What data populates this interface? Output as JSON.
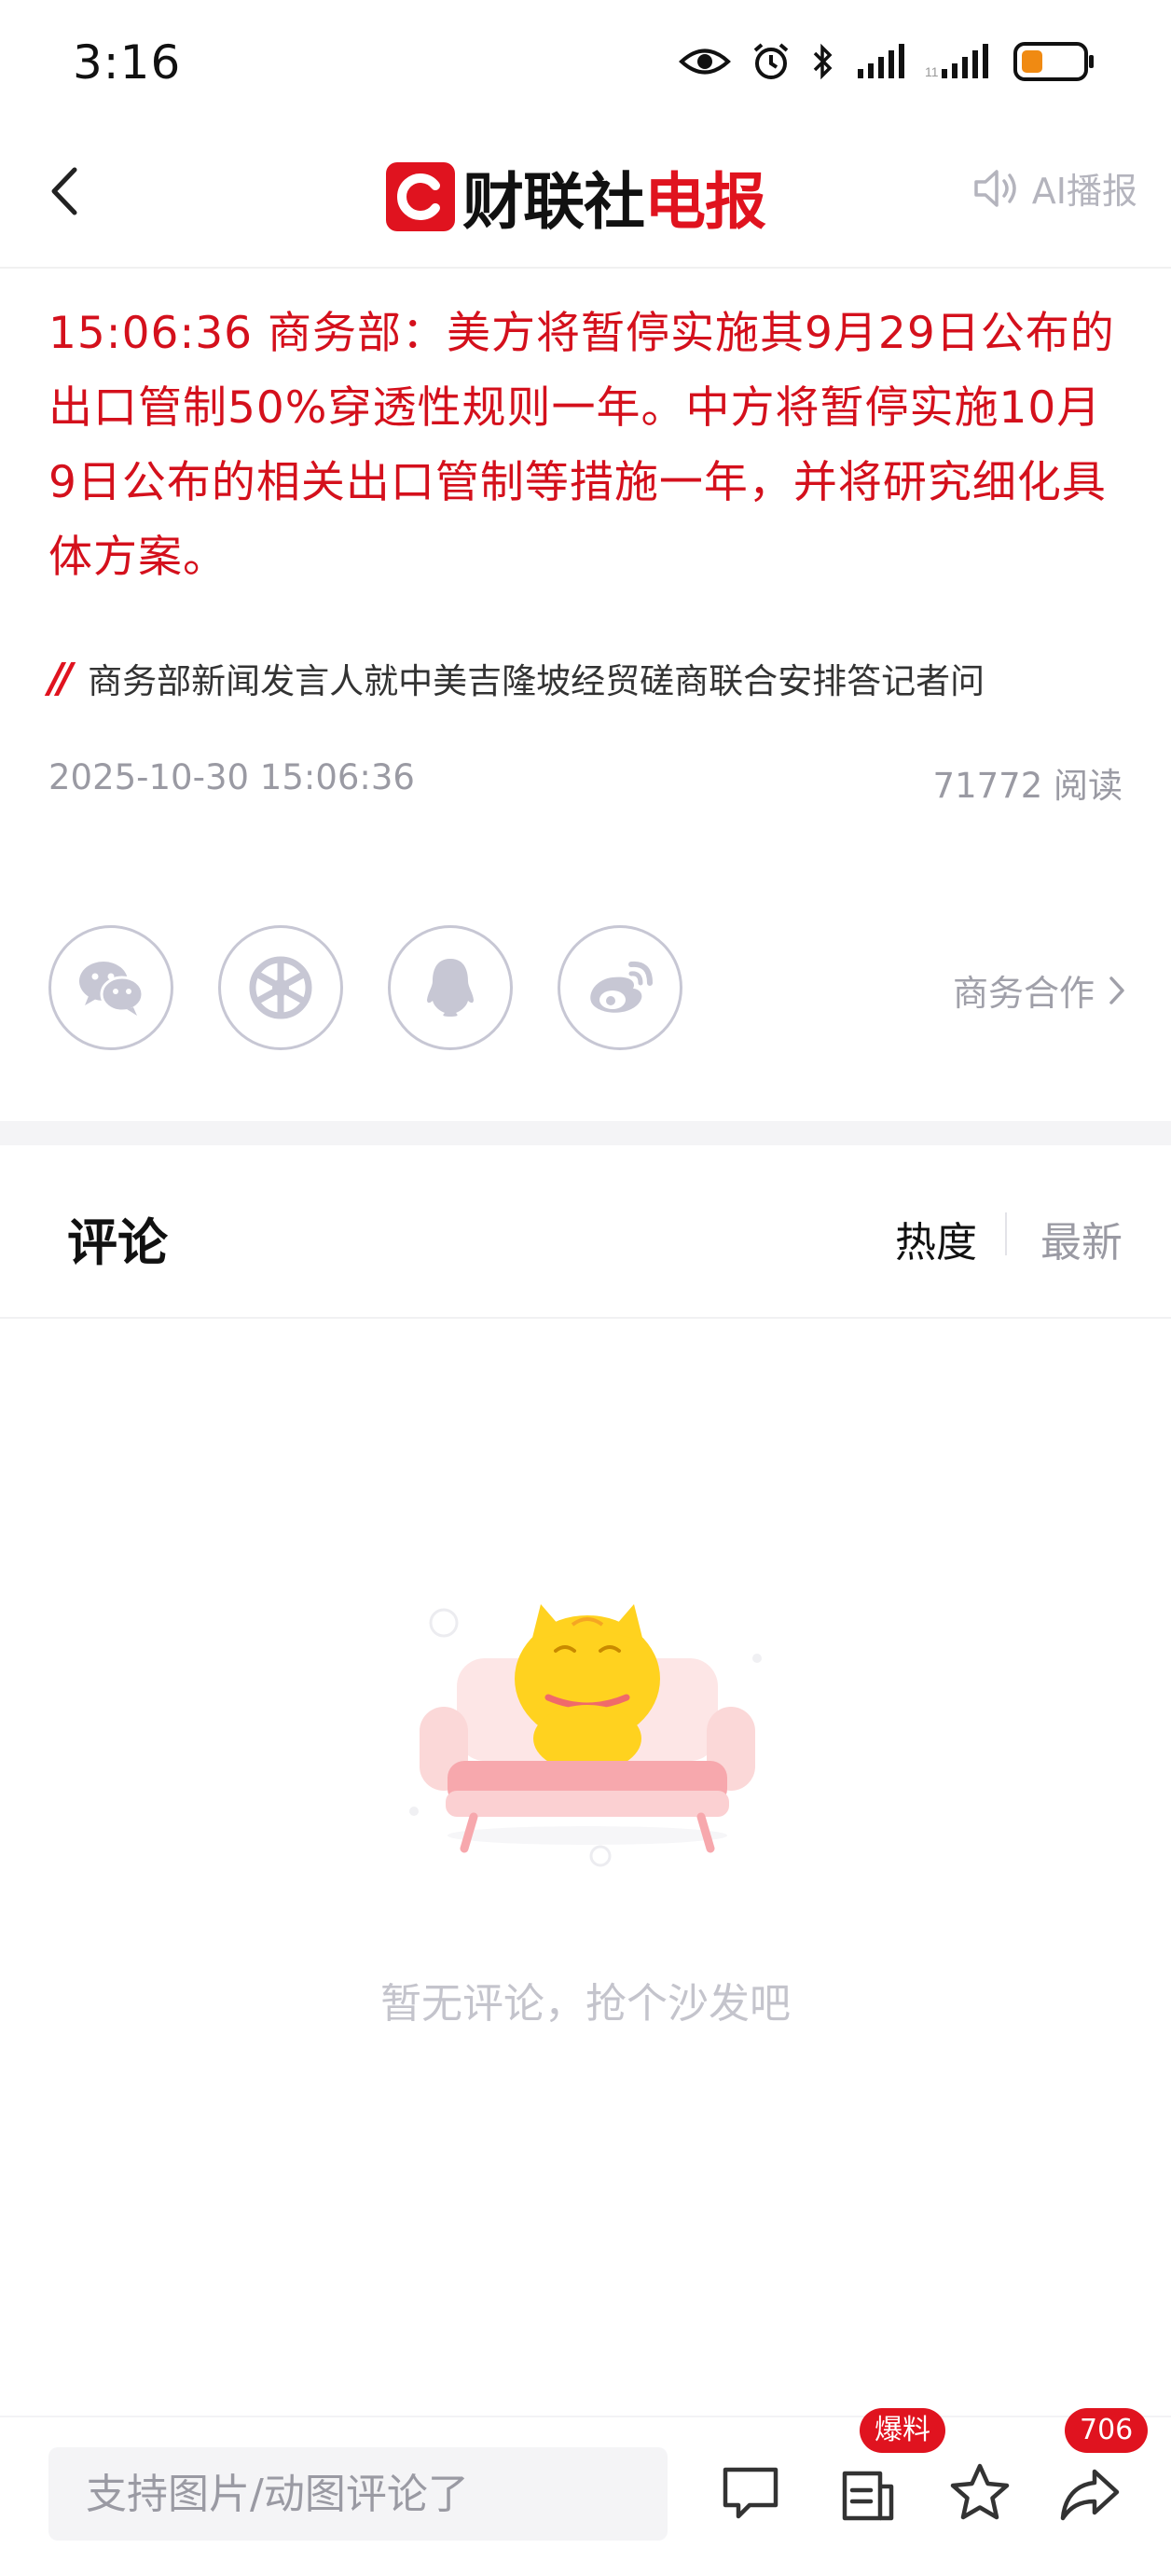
{
  "status_bar": {
    "time": "3:16"
  },
  "header": {
    "logo_text_black": "财联社",
    "logo_text_red": "电报",
    "ai_label": "AI播报"
  },
  "article": {
    "headline": "15:06:36  商务部：美方将暂停实施其9月29日公布的出口管制50%穿透性规则一年。中方将暂停实施10月9日公布的相关出口管制等措施一年，并将研究细化具体方案。",
    "source_text": "商务部新闻发言人就中美吉隆坡经贸磋商联合安排答记者问",
    "datetime": "2025-10-30 15:06:36",
    "read_count": "71772 阅读"
  },
  "share": {
    "icons": [
      "wechat-icon",
      "moments-icon",
      "qq-icon",
      "weibo-icon"
    ],
    "biz_label": "商务合作"
  },
  "comments": {
    "title": "评论",
    "sort_hot": "热度",
    "sort_new": "最新",
    "empty_text": "暂无评论，抢个沙发吧"
  },
  "bottom_bar": {
    "input_placeholder": "支持图片/动图评论了",
    "report_badge": "爆料",
    "share_badge": "706"
  },
  "colors": {
    "brand_red": "#e0131f",
    "headline_red": "#d4101c"
  }
}
